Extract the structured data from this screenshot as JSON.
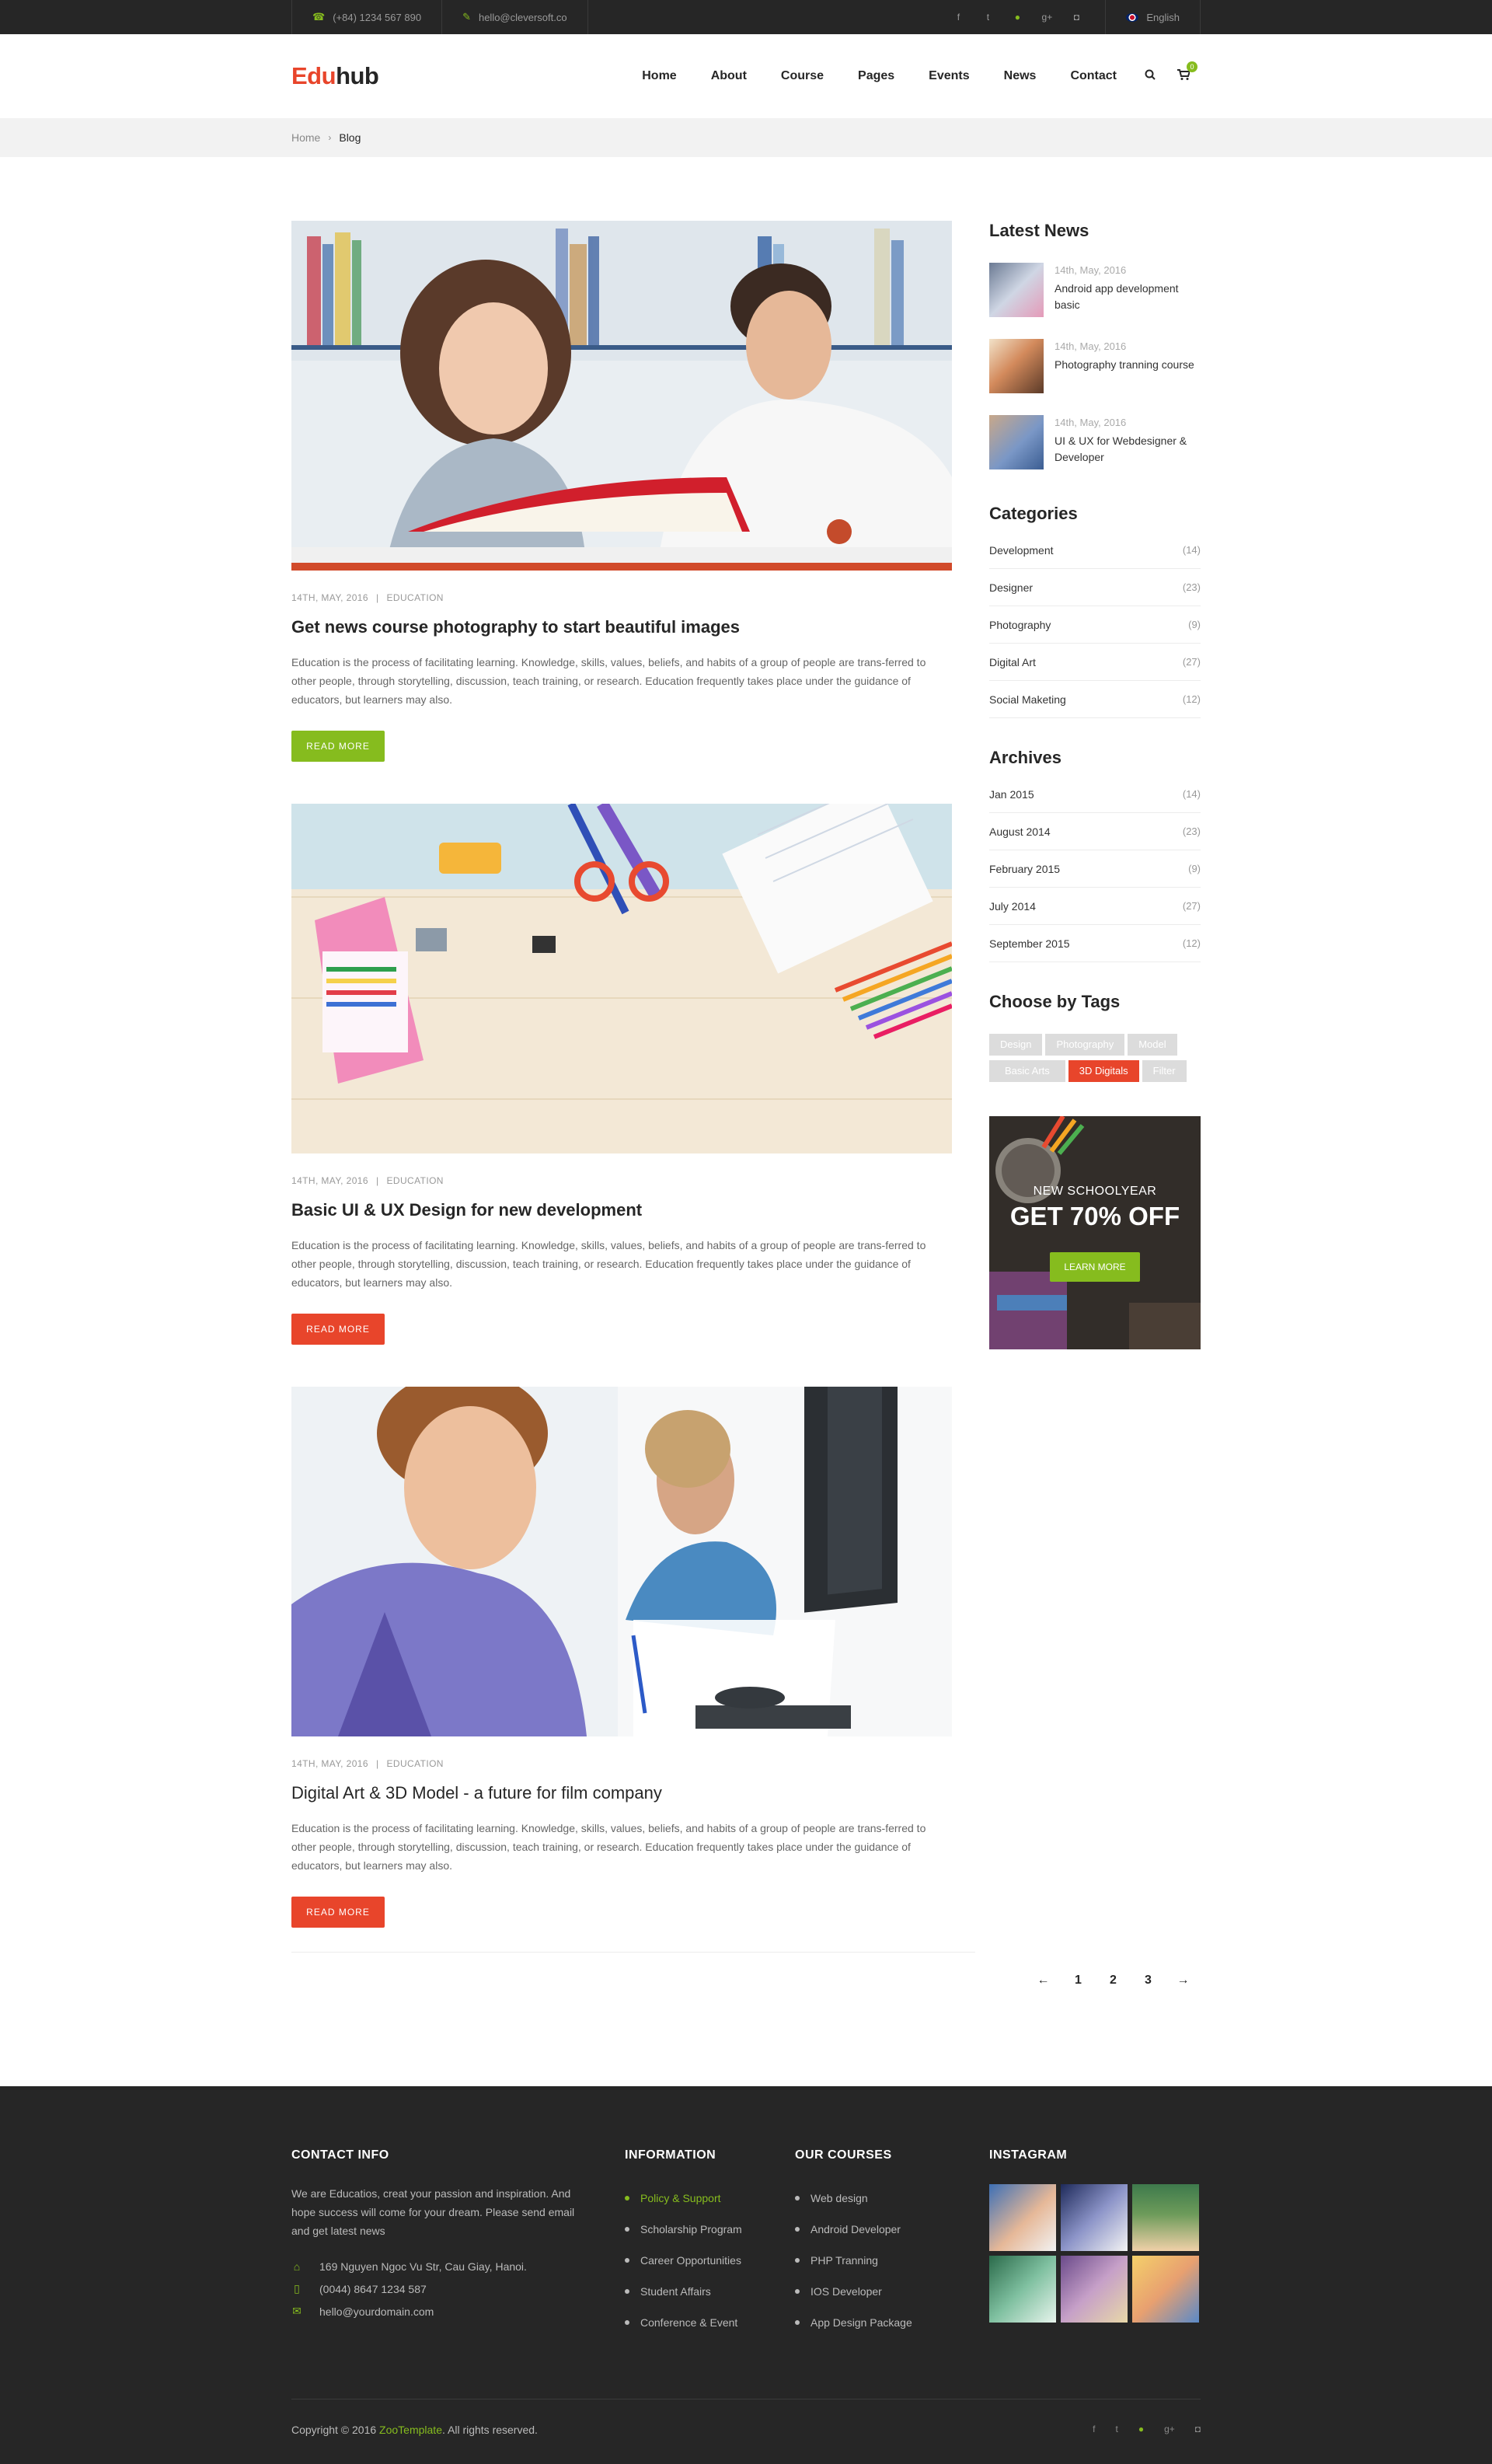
{
  "topbar": {
    "phone": "(+84) 1234 567 890",
    "email": "hello@cleversoft.co",
    "social": [
      "f",
      "t",
      "d",
      "g+",
      "ig"
    ],
    "language": "English"
  },
  "header": {
    "logo_part1": "Edu",
    "logo_part2": "hub",
    "nav": [
      "Home",
      "About",
      "Course",
      "Pages",
      "Events",
      "News",
      "Contact"
    ],
    "cart_count": "0"
  },
  "breadcrumb": {
    "home": "Home",
    "current": "Blog"
  },
  "posts": [
    {
      "date": "14TH, MAY, 2016",
      "category": "EDUCATION",
      "title": "Get news course photography to start beautiful images",
      "excerpt": "Education is the process of facilitating learning. Knowledge, skills, values, beliefs, and habits of a group of people are trans-ferred to other people, through storytelling, discussion, teach training, or research. Education frequently takes place under the guidance of educators, but learners may also.",
      "button": "READ MORE"
    },
    {
      "date": "14TH, MAY, 2016",
      "category": "EDUCATION",
      "title": "Basic UI & UX Design for new development",
      "excerpt": "Education is the process of facilitating learning. Knowledge, skills, values, beliefs, and habits of a group of people are trans-ferred to other people, through storytelling, discussion, teach training, or research. Education frequently takes place under the guidance of educators, but learners may also.",
      "button": "READ MORE"
    },
    {
      "date": "14TH, MAY, 2016",
      "category": "EDUCATION",
      "title": "Digital Art & 3D Model - a future for film company",
      "excerpt": "Education is the process of facilitating learning. Knowledge, skills, values, beliefs, and habits of a group of people are trans-ferred to other people, through storytelling, discussion, teach training, or research. Education frequently takes place under the guidance of educators, but learners may also.",
      "button": "READ MORE"
    }
  ],
  "pagination": {
    "prev": "←",
    "pages": [
      "1",
      "2",
      "3"
    ],
    "next": "→"
  },
  "sidebar": {
    "latest_title": "Latest News",
    "latest": [
      {
        "date": "14th, May, 2016",
        "title": "Android app development basic"
      },
      {
        "date": "14th, May, 2016",
        "title": "Photography tranning course"
      },
      {
        "date": "14th, May, 2016",
        "title": "UI & UX for Webdesigner & Developer"
      }
    ],
    "categories_title": "Categories",
    "categories": [
      {
        "name": "Development",
        "count": "(14)"
      },
      {
        "name": "Designer",
        "count": "(23)"
      },
      {
        "name": "Photography",
        "count": "(9)"
      },
      {
        "name": "Digital Art",
        "count": "(27)"
      },
      {
        "name": "Social Maketing",
        "count": "(12)"
      }
    ],
    "archives_title": "Archives",
    "archives": [
      {
        "name": "Jan 2015",
        "count": "(14)"
      },
      {
        "name": "August 2014",
        "count": "(23)"
      },
      {
        "name": "February 2015",
        "count": "(9)"
      },
      {
        "name": "July 2014",
        "count": "(27)"
      },
      {
        "name": "September 2015",
        "count": "(12)"
      }
    ],
    "tags_title": "Choose by Tags",
    "tags": [
      "Design",
      "Photography",
      "Model",
      "Basic Arts",
      "3D Digitals",
      "Filter"
    ],
    "promo": {
      "kicker": "NEW SCHOOLYEAR",
      "headline": "GET 70% OFF",
      "button": "LEARN MORE"
    }
  },
  "footer": {
    "contact_title": "CONTACT INFO",
    "contact_text": "We are Educatios, creat your passion and inspiration. And hope success will come for your dream. Please send email and get latest news",
    "address": "169 Nguyen Ngoc Vu Str, Cau Giay, Hanoi.",
    "phone": "(0044) 8647 1234 587",
    "email": "hello@yourdomain.com",
    "info_title": "INFORMATION",
    "info_links": [
      "Policy & Support",
      "Scholarship Program",
      "Career Opportunities",
      "Student Affairs",
      "Conference & Event"
    ],
    "courses_title": "OUR COURSES",
    "courses_links": [
      "Web design",
      "Android Developer",
      "PHP Tranning",
      "IOS Developer",
      "App Design Package"
    ],
    "instagram_title": "INSTAGRAM",
    "copyright_prefix": "Copyright © 2016",
    "copyright_brand": "ZooTemplate",
    "copyright_suffix": ". All rights reserved.",
    "social": [
      "f",
      "t",
      "d",
      "g+",
      "ig"
    ]
  },
  "colors": {
    "accent_green": "#86bc1e",
    "accent_red": "#e8452b",
    "dark": "#262626"
  }
}
